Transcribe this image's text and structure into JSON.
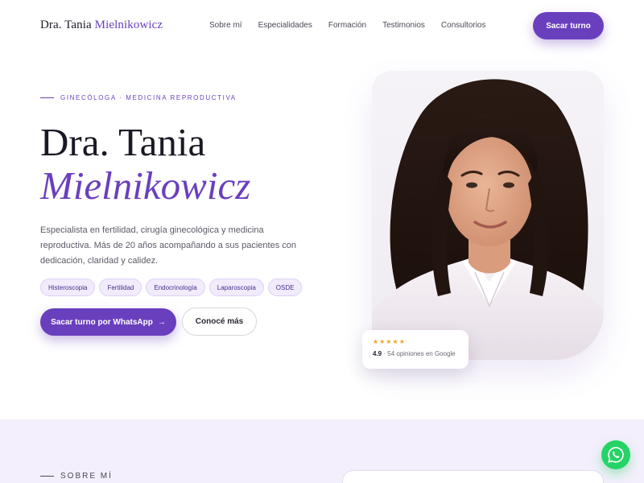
{
  "brand": {
    "name_plain": "Dra. Tania",
    "name_accent": "Mielnikowicz"
  },
  "nav": {
    "items": [
      "Sobre mí",
      "Especialidades",
      "Formación",
      "Testimonios",
      "Consultorios"
    ],
    "cta_label": "Sacar turno"
  },
  "hero": {
    "eyebrow": "GINECÓLOGA · MEDICINA REPRODUCTIVA",
    "title_line1": "Dra. Tania",
    "title_line2": "Mielnikowicz",
    "description": "Especialista en fertilidad, cirugía ginecológica y medicina reproductiva. Más de 20 años acompañando a sus pacientes con dedicación, claridad y calidez.",
    "tags": [
      "Histeroscopia",
      "Fertilidad",
      "Endocrinología",
      "Laparoscopia",
      "OSDE"
    ],
    "primary_button": "Sacar turno por WhatsApp",
    "primary_button_arrow": "→",
    "secondary_button": "Conocé más"
  },
  "rating": {
    "stars": "★★★★★",
    "score": "4.9",
    "count_text": "· 54 opiniones en Google"
  },
  "about": {
    "eyebrow": "SOBRE MÍ"
  },
  "colors": {
    "accent": "#6a3fbe",
    "chip_bg": "#f1ebfc",
    "band_bg": "#f4effc",
    "star": "#f0a41f",
    "whatsapp": "#25d366"
  },
  "icons": {
    "whatsapp_fab": "whatsapp-icon"
  }
}
